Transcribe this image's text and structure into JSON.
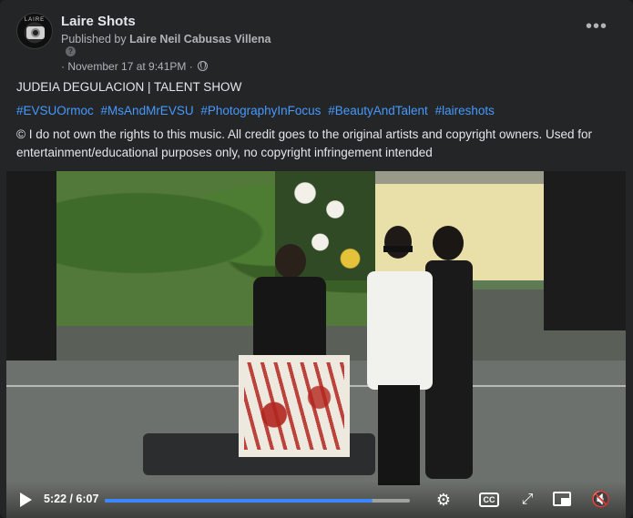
{
  "header": {
    "page_name": "Laire Shots",
    "published_prefix": "Published by",
    "published_by": "Laire Neil Cabusas Villena",
    "date": "· November 17 at 9:41PM ·",
    "privacy_icon": "globe-icon",
    "more_icon": "more-options-icon",
    "more_glyph": "•••"
  },
  "caption": {
    "title": "JUDEIA DEGULACION | TALENT SHOW",
    "hashtags": [
      "#EVSUOrmoc",
      "#MsAndMrEVSU",
      "#PhotographyInFocus",
      "#BeautyAndTalent",
      "#laireshots"
    ],
    "disclaimer": "© I do not own the rights to this music. All credit goes to the original artists and copyright owners. Used for entertainment/educational purposes only, no copyright infringement intended"
  },
  "video": {
    "time": "5:22 / 6:07",
    "progress": 0.877,
    "controls": {
      "play_icon": "play-icon",
      "settings_icon": "gear-icon",
      "settings_glyph": "⚙",
      "captions_icon": "closed-captions-icon",
      "captions_label": "CC",
      "fullscreen_icon": "expand-icon",
      "fullscreen_glyph": "⤢",
      "pip_icon": "picture-in-picture-icon",
      "mute_icon": "speaker-muted-icon",
      "mute_glyph": "🔇"
    }
  },
  "colors": {
    "background": "#242526",
    "text": "#e4e6eb",
    "secondary_text": "#b0b3b8",
    "hashtag": "#4599ff",
    "progress": "#3c87ff"
  }
}
